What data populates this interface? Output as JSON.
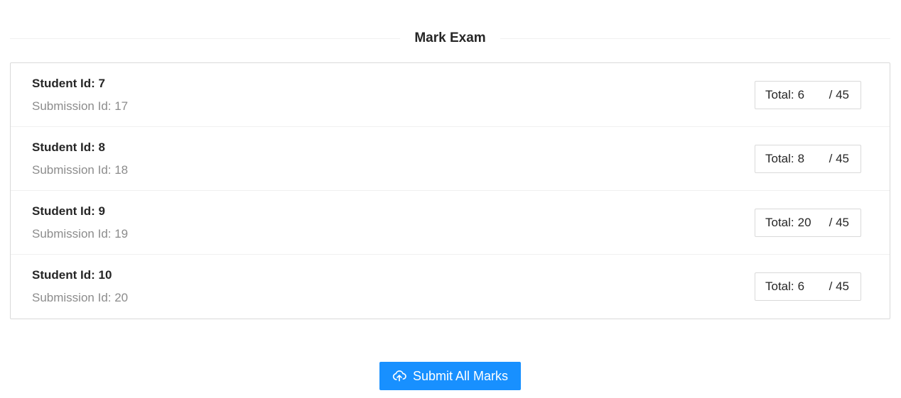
{
  "title": "Mark Exam",
  "submissions": [
    {
      "student_label": "Student Id: 7",
      "submission_label": "Submission Id: 17",
      "total_label": "Total:",
      "score": "6",
      "max": "/ 45"
    },
    {
      "student_label": "Student Id: 8",
      "submission_label": "Submission Id: 18",
      "total_label": "Total:",
      "score": "8",
      "max": "/ 45"
    },
    {
      "student_label": "Student Id: 9",
      "submission_label": "Submission Id: 19",
      "total_label": "Total:",
      "score": "20",
      "max": "/ 45"
    },
    {
      "student_label": "Student Id: 10",
      "submission_label": "Submission Id: 20",
      "total_label": "Total:",
      "score": "6",
      "max": "/ 45"
    }
  ],
  "submit_button": {
    "label": "Submit All Marks",
    "icon": "cloud-upload-icon"
  },
  "colors": {
    "primary": "#1890ff",
    "border": "#d9d9d9",
    "muted_text": "#8c8c8c"
  }
}
